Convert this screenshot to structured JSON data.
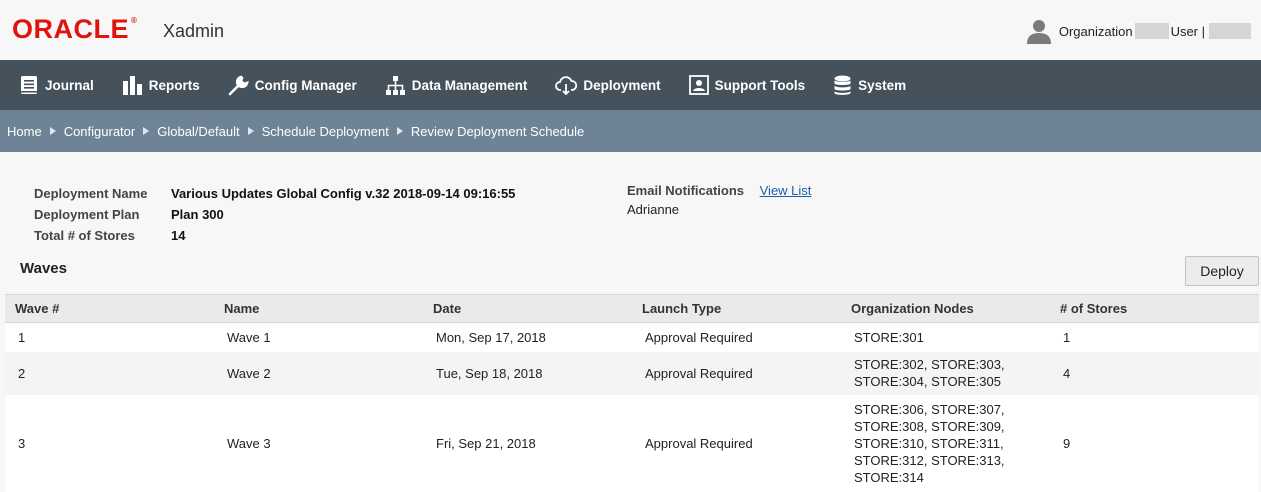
{
  "header": {
    "logo": "ORACLE",
    "logo_mark": "®",
    "app_name": "Xadmin",
    "org_label": "Organization",
    "user_label": "User |",
    "user_icon": "user-icon"
  },
  "nav": {
    "items": [
      {
        "label": "Journal",
        "icon": "journal-icon"
      },
      {
        "label": "Reports",
        "icon": "reports-icon"
      },
      {
        "label": "Config Manager",
        "icon": "wrench-icon"
      },
      {
        "label": "Data Management",
        "icon": "hierarchy-icon"
      },
      {
        "label": "Deployment",
        "icon": "cloud-download-icon"
      },
      {
        "label": "Support Tools",
        "icon": "support-icon"
      },
      {
        "label": "System",
        "icon": "database-icon"
      }
    ]
  },
  "breadcrumb": [
    "Home",
    "Configurator",
    "Global/Default",
    "Schedule Deployment",
    "Review Deployment Schedule"
  ],
  "deployment": {
    "name_label": "Deployment Name",
    "name_value": "Various Updates Global Config v.32 2018-09-14 09:16:55",
    "plan_label": "Deployment Plan",
    "plan_value": "Plan 300",
    "stores_label": "Total # of Stores",
    "stores_value": "14",
    "email_label": "Email Notifications",
    "email_link": "View List",
    "email_name": "Adrianne"
  },
  "waves": {
    "title": "Waves",
    "deploy_button": "Deploy",
    "columns": [
      "Wave #",
      "Name",
      "Date",
      "Launch Type",
      "Organization Nodes",
      "# of Stores"
    ],
    "rows": [
      {
        "wave": "1",
        "name": "Wave 1",
        "date": "Mon, Sep 17, 2018",
        "launch": "Approval Required",
        "nodes": [
          "STORE:301"
        ],
        "stores": "1"
      },
      {
        "wave": "2",
        "name": "Wave 2",
        "date": "Tue, Sep 18, 2018",
        "launch": "Approval Required",
        "nodes": [
          "STORE:302, STORE:303,",
          "STORE:304, STORE:305"
        ],
        "stores": "4"
      },
      {
        "wave": "3",
        "name": "Wave 3",
        "date": "Fri, Sep 21, 2018",
        "launch": "Approval Required",
        "nodes": [
          "STORE:306, STORE:307,",
          "STORE:308, STORE:309,",
          "STORE:310, STORE:311,",
          "STORE:312, STORE:313,",
          "STORE:314"
        ],
        "stores": "9"
      }
    ]
  },
  "colors": {
    "brand_red": "#e0140c",
    "nav_bg": "#46525b",
    "breadcrumb_bg": "#6e8396",
    "link": "#1a5fa8"
  }
}
